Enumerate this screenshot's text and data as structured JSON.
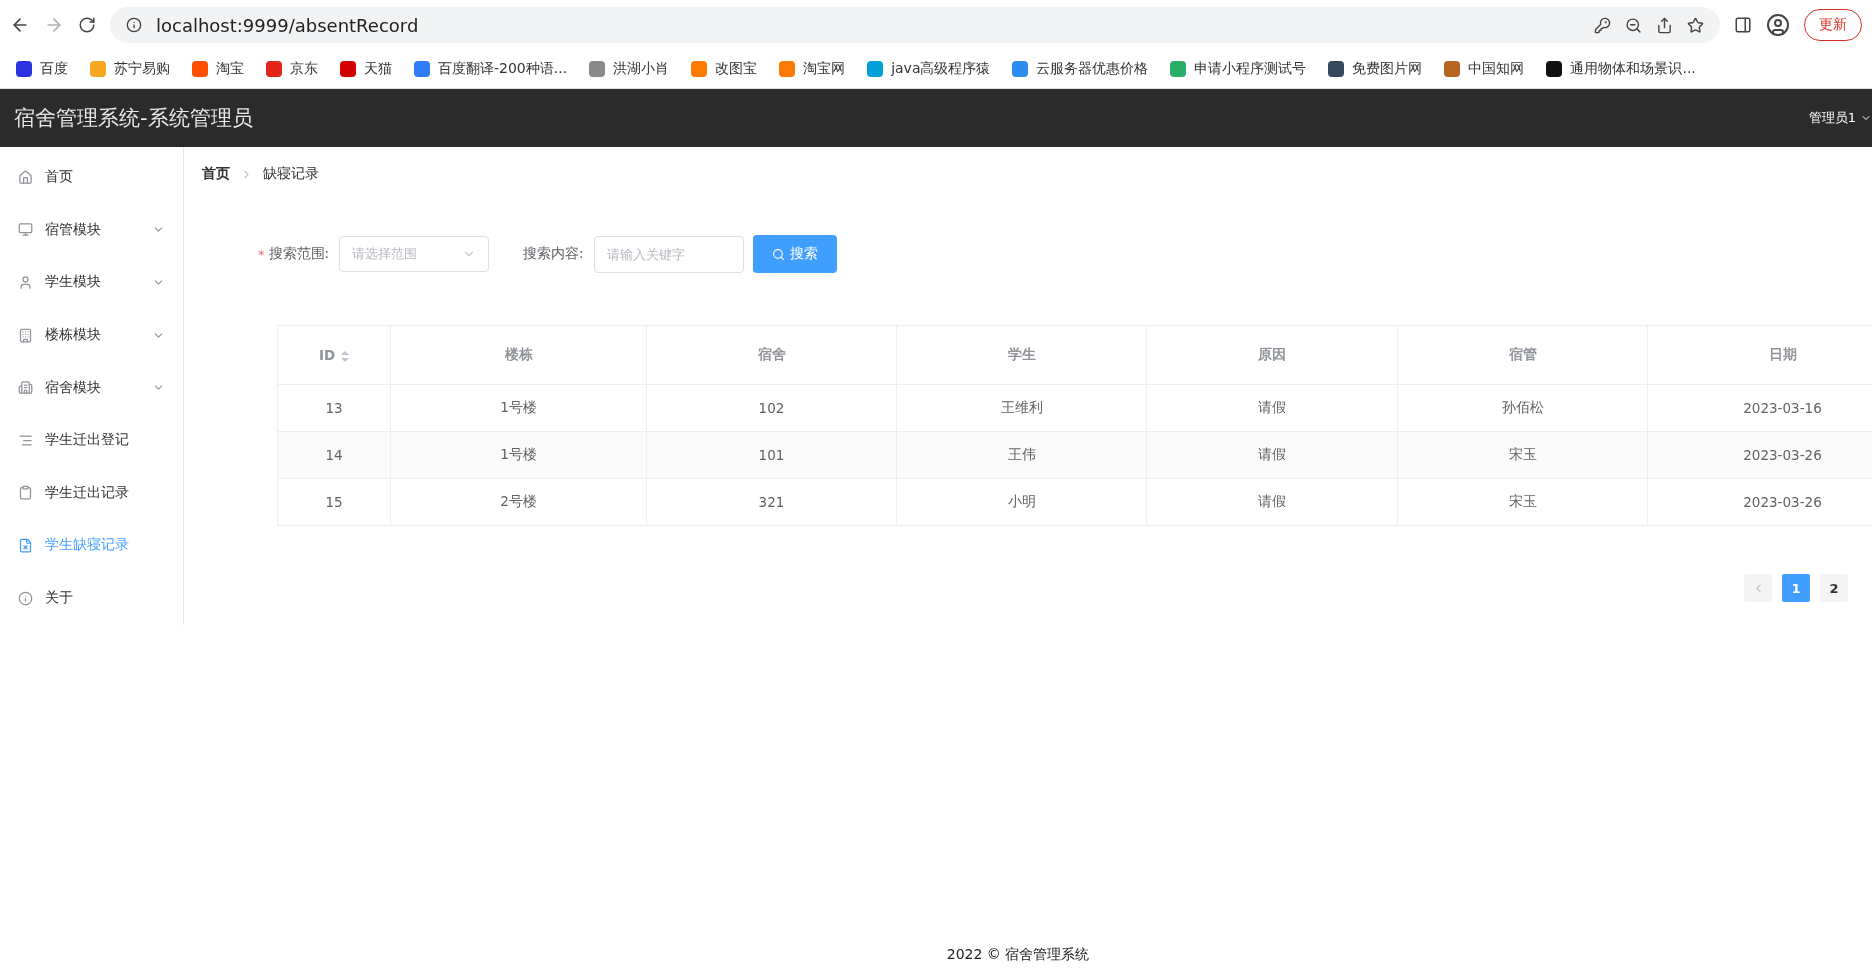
{
  "browser": {
    "url": "localhost:9999/absentRecord",
    "update_button": "更新",
    "bookmarks": [
      {
        "label": "百度",
        "color": "#2932e1"
      },
      {
        "label": "苏宁易购",
        "color": "#f5a623"
      },
      {
        "label": "淘宝",
        "color": "#ff5000"
      },
      {
        "label": "京东",
        "color": "#e1251b"
      },
      {
        "label": "天猫",
        "color": "#d00000"
      },
      {
        "label": "百度翻译-200种语...",
        "color": "#2e7cf6"
      },
      {
        "label": "洪湖小肖",
        "color": "#8a8a8a"
      },
      {
        "label": "改图宝",
        "color": "#ff7a00"
      },
      {
        "label": "淘宝网",
        "color": "#ff7a00"
      },
      {
        "label": "java高级程序猿",
        "color": "#00a1d6"
      },
      {
        "label": "云服务器优惠价格",
        "color": "#2d8cf0"
      },
      {
        "label": "申请小程序测试号",
        "color": "#2aae67"
      },
      {
        "label": "免费图片网",
        "color": "#34495e"
      },
      {
        "label": "中国知网",
        "color": "#b5651d"
      },
      {
        "label": "通用物体和场景识...",
        "color": "#111111"
      }
    ]
  },
  "header": {
    "title": "宿舍管理系统-系统管理员",
    "user": "管理员1"
  },
  "sidebar": {
    "items": [
      {
        "label": "首页",
        "kind": "home",
        "expandable": false,
        "selected": false
      },
      {
        "label": "宿管模块",
        "kind": "monitor",
        "expandable": true,
        "selected": false
      },
      {
        "label": "学生模块",
        "kind": "user",
        "expandable": true,
        "selected": false
      },
      {
        "label": "楼栋模块",
        "kind": "building",
        "expandable": true,
        "selected": false
      },
      {
        "label": "宿舍模块",
        "kind": "office",
        "expandable": true,
        "selected": false
      },
      {
        "label": "学生迁出登记",
        "kind": "list",
        "expandable": false,
        "selected": false
      },
      {
        "label": "学生迁出记录",
        "kind": "clipboard",
        "expandable": false,
        "selected": false
      },
      {
        "label": "学生缺寝记录",
        "kind": "file",
        "expandable": false,
        "selected": true
      },
      {
        "label": "关于",
        "kind": "info",
        "expandable": false,
        "selected": false
      }
    ]
  },
  "breadcrumb": [
    "首页",
    "缺寝记录"
  ],
  "search": {
    "range_label": "搜索范围:",
    "required_mark": "*",
    "range_placeholder": "请选择范围",
    "content_label": "搜索内容:",
    "content_placeholder": "请输入关键字",
    "button": "搜索"
  },
  "table": {
    "columns": [
      {
        "label": "ID",
        "sortable": true
      },
      {
        "label": "楼栋",
        "sortable": false
      },
      {
        "label": "宿舍",
        "sortable": false
      },
      {
        "label": "学生",
        "sortable": false
      },
      {
        "label": "原因",
        "sortable": false
      },
      {
        "label": "宿管",
        "sortable": false
      },
      {
        "label": "日期",
        "sortable": false
      }
    ],
    "rows": [
      [
        "13",
        "1号楼",
        "102",
        "王维利",
        "请假",
        "孙佰松",
        "2023-03-16"
      ],
      [
        "14",
        "1号楼",
        "101",
        "王伟",
        "请假",
        "宋玉",
        "2023-03-26"
      ],
      [
        "15",
        "2号楼",
        "321",
        "小明",
        "请假",
        "宋玉",
        "2023-03-26"
      ]
    ]
  },
  "pagination": {
    "pages": [
      {
        "label": "1",
        "selected": true
      },
      {
        "label": "2",
        "selected": false
      }
    ]
  },
  "footer": "2022 © 宿舍管理系统"
}
